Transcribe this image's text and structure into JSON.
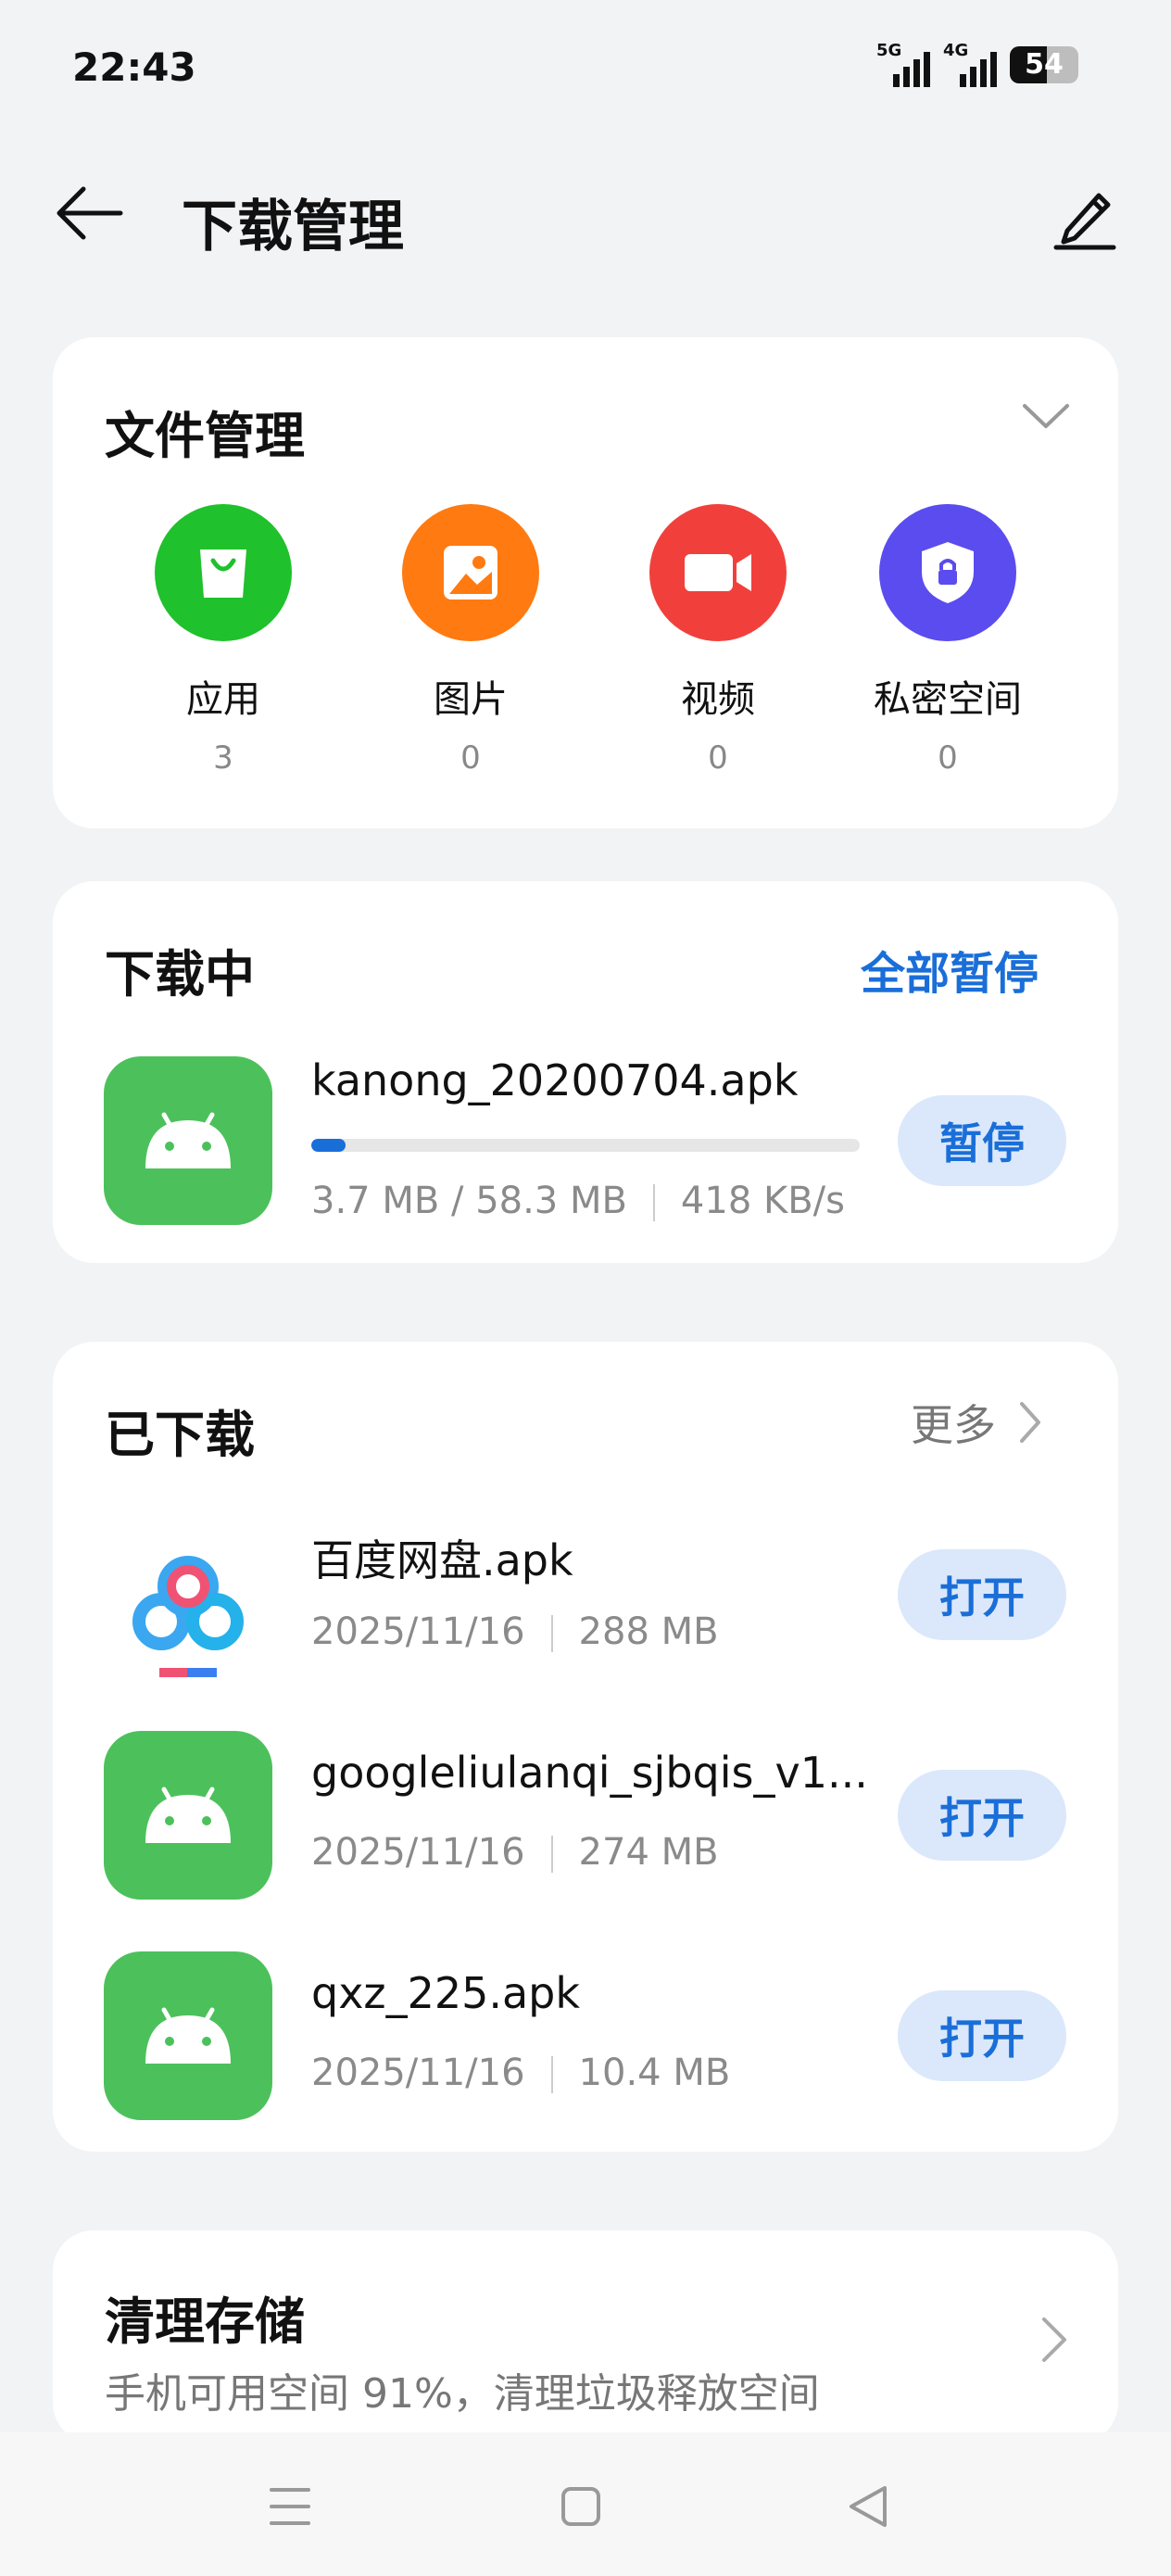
{
  "status": {
    "time": "22:43",
    "net1": "5G",
    "net2": "4G",
    "battery": "54",
    "battery_level": 0.54
  },
  "header": {
    "title": "下载管理",
    "back_icon": "arrow-left-icon",
    "edit_icon": "pencil-icon"
  },
  "file_management": {
    "title": "文件管理",
    "categories": [
      {
        "label": "应用",
        "count": "3",
        "color": "#1fc12c",
        "icon": "shopping-bag-icon"
      },
      {
        "label": "图片",
        "count": "0",
        "color": "#ff7a10",
        "icon": "image-icon"
      },
      {
        "label": "视频",
        "count": "0",
        "color": "#f1403b",
        "icon": "video-camera-icon"
      },
      {
        "label": "私密空间",
        "count": "0",
        "color": "#5a4cee",
        "icon": "shield-lock-icon"
      }
    ]
  },
  "downloading": {
    "title": "下载中",
    "pause_all": "全部暂停",
    "items": [
      {
        "name": "kanong_20200704.apk",
        "size": "3.7 MB / 58.3 MB",
        "speed": "418 KB/s",
        "progress": 0.063,
        "action": "暂停"
      }
    ]
  },
  "downloaded": {
    "title": "已下载",
    "more": "更多",
    "items": [
      {
        "name": "百度网盘.apk",
        "date": "2025/11/16",
        "size": "288 MB",
        "action": "打开",
        "icon": "baidu-netdisk-icon"
      },
      {
        "name": "googleliulanqi_sjbqis_v1...",
        "date": "2025/11/16",
        "size": "274 MB",
        "action": "打开",
        "icon": "android-icon"
      },
      {
        "name": "qxz_225.apk",
        "date": "2025/11/16",
        "size": "10.4 MB",
        "action": "打开",
        "icon": "android-icon"
      }
    ]
  },
  "clean": {
    "title": "清理存储",
    "subtitle": "手机可用空间 91%，清理垃圾释放空间"
  },
  "colors": {
    "accent": "#1a6ed8",
    "android_green": "#4cc15b",
    "background": "#f1f3f5"
  }
}
